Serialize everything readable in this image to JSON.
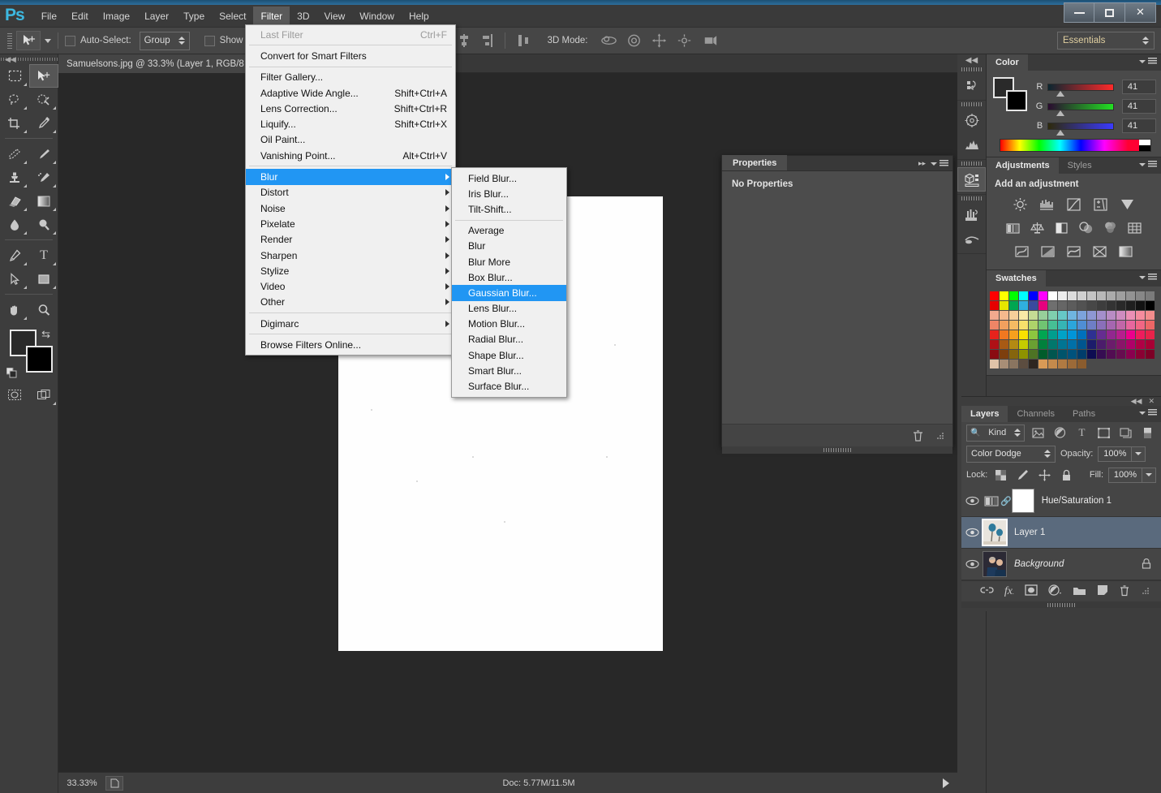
{
  "window": {
    "controls": [
      {
        "name": "minimize",
        "label": "—"
      },
      {
        "name": "maximize",
        "label": "❐"
      },
      {
        "name": "close",
        "label": "✕"
      }
    ]
  },
  "menubar": {
    "logo": "Ps",
    "items": [
      {
        "label": "File",
        "active": false
      },
      {
        "label": "Edit",
        "active": false
      },
      {
        "label": "Image",
        "active": false
      },
      {
        "label": "Layer",
        "active": false
      },
      {
        "label": "Type",
        "active": false
      },
      {
        "label": "Select",
        "active": false
      },
      {
        "label": "Filter",
        "active": true
      },
      {
        "label": "3D",
        "active": false
      },
      {
        "label": "View",
        "active": false
      },
      {
        "label": "Window",
        "active": false
      },
      {
        "label": "Help",
        "active": false
      }
    ]
  },
  "options_bar": {
    "auto_select_label": "Auto-Select:",
    "auto_select_checked": false,
    "group_value": "Group",
    "show_transform_label": "Show Tran",
    "show_transform_checked": false,
    "mode3d_label": "3D Mode:",
    "workspace": "Essentials"
  },
  "document": {
    "tab_title": "Samuelsons.jpg @ 33.3% (Layer 1, RGB/8"
  },
  "status_bar": {
    "zoom": "33.33%",
    "doc_info": "Doc: 5.77M/11.5M"
  },
  "filter_menu": {
    "items": [
      {
        "label": "Last Filter",
        "shortcut": "Ctrl+F",
        "disabled": true,
        "submenu": false,
        "highlight": false
      },
      {
        "separator": true
      },
      {
        "label": "Convert for Smart Filters",
        "shortcut": "",
        "disabled": false,
        "submenu": false,
        "highlight": false
      },
      {
        "separator": true
      },
      {
        "label": "Filter Gallery...",
        "shortcut": "",
        "disabled": false,
        "submenu": false,
        "highlight": false
      },
      {
        "label": "Adaptive Wide Angle...",
        "shortcut": "Shift+Ctrl+A",
        "disabled": false,
        "submenu": false,
        "highlight": false
      },
      {
        "label": "Lens Correction...",
        "shortcut": "Shift+Ctrl+R",
        "disabled": false,
        "submenu": false,
        "highlight": false
      },
      {
        "label": "Liquify...",
        "shortcut": "Shift+Ctrl+X",
        "disabled": false,
        "submenu": false,
        "highlight": false
      },
      {
        "label": "Oil Paint...",
        "shortcut": "",
        "disabled": false,
        "submenu": false,
        "highlight": false
      },
      {
        "label": "Vanishing Point...",
        "shortcut": "Alt+Ctrl+V",
        "disabled": false,
        "submenu": false,
        "highlight": false
      },
      {
        "separator": true
      },
      {
        "label": "Blur",
        "shortcut": "",
        "disabled": false,
        "submenu": true,
        "highlight": true
      },
      {
        "label": "Distort",
        "shortcut": "",
        "disabled": false,
        "submenu": true,
        "highlight": false
      },
      {
        "label": "Noise",
        "shortcut": "",
        "disabled": false,
        "submenu": true,
        "highlight": false
      },
      {
        "label": "Pixelate",
        "shortcut": "",
        "disabled": false,
        "submenu": true,
        "highlight": false
      },
      {
        "label": "Render",
        "shortcut": "",
        "disabled": false,
        "submenu": true,
        "highlight": false
      },
      {
        "label": "Sharpen",
        "shortcut": "",
        "disabled": false,
        "submenu": true,
        "highlight": false
      },
      {
        "label": "Stylize",
        "shortcut": "",
        "disabled": false,
        "submenu": true,
        "highlight": false
      },
      {
        "label": "Video",
        "shortcut": "",
        "disabled": false,
        "submenu": true,
        "highlight": false
      },
      {
        "label": "Other",
        "shortcut": "",
        "disabled": false,
        "submenu": true,
        "highlight": false
      },
      {
        "separator": true
      },
      {
        "label": "Digimarc",
        "shortcut": "",
        "disabled": false,
        "submenu": true,
        "highlight": false
      },
      {
        "separator": true
      },
      {
        "label": "Browse Filters Online...",
        "shortcut": "",
        "disabled": false,
        "submenu": false,
        "highlight": false
      }
    ]
  },
  "blur_submenu": {
    "items": [
      {
        "label": "Field Blur...",
        "highlight": false
      },
      {
        "label": "Iris Blur...",
        "highlight": false
      },
      {
        "label": "Tilt-Shift...",
        "highlight": false
      },
      {
        "separator": true
      },
      {
        "label": "Average",
        "highlight": false
      },
      {
        "label": "Blur",
        "highlight": false
      },
      {
        "label": "Blur More",
        "highlight": false
      },
      {
        "label": "Box Blur...",
        "highlight": false
      },
      {
        "label": "Gaussian Blur...",
        "highlight": true
      },
      {
        "label": "Lens Blur...",
        "highlight": false
      },
      {
        "label": "Motion Blur...",
        "highlight": false
      },
      {
        "label": "Radial Blur...",
        "highlight": false
      },
      {
        "label": "Shape Blur...",
        "highlight": false
      },
      {
        "label": "Smart Blur...",
        "highlight": false
      },
      {
        "label": "Surface Blur...",
        "highlight": false
      }
    ]
  },
  "properties_panel": {
    "tab": "Properties",
    "empty_text": "No Properties"
  },
  "color_panel": {
    "tab": "Color",
    "channels": [
      {
        "label": "R",
        "value": "41"
      },
      {
        "label": "G",
        "value": "41"
      },
      {
        "label": "B",
        "value": "41"
      }
    ],
    "foreground": "#2a2a2a",
    "background": "#000000"
  },
  "adjustments_panel": {
    "tabs": [
      {
        "label": "Adjustments",
        "selected": true
      },
      {
        "label": "Styles",
        "selected": false
      }
    ],
    "title": "Add an adjustment",
    "icons": [
      [
        "brightness-contrast-icon",
        "levels-icon",
        "curves-icon",
        "exposure-icon",
        "vibrance-icon"
      ],
      [
        "hue-saturation-icon",
        "color-balance-icon",
        "black-white-icon",
        "photo-filter-icon",
        "channel-mixer-icon",
        "color-lookup-icon"
      ],
      [
        "invert-icon",
        "posterize-icon",
        "threshold-icon",
        "selective-color-icon",
        "gradient-map-icon"
      ]
    ]
  },
  "swatches_panel": {
    "tab": "Swatches",
    "colors": [
      [
        "#ff0000",
        "#ffff00",
        "#00ff00",
        "#00ffff",
        "#0000ff",
        "#ff00ff",
        "#ffffff",
        "#ededed",
        "#dcdcdc",
        "#d0d0d0",
        "#c4c4c4",
        "#b8b8b8",
        "#ababab",
        "#9f9f9f",
        "#939393",
        "#878787",
        "#7b7b7b"
      ],
      [
        "#e60000",
        "#e6e600",
        "#00a651",
        "#2fb0e0",
        "#3a4a9e",
        "#e6007e",
        "#6f6f6f",
        "#666666",
        "#5c5c5c",
        "#525252",
        "#474747",
        "#3d3d3d",
        "#333333",
        "#292929",
        "#1f1f1f",
        "#121212",
        "#000000"
      ],
      [
        "#f2a98e",
        "#f5b98d",
        "#f7cf9a",
        "#faeaa6",
        "#c5dc94",
        "#97cf9a",
        "#7fcfae",
        "#66c7c7",
        "#6fb5e0",
        "#7ca3dc",
        "#8e97d4",
        "#a48fcb",
        "#b98cc4",
        "#cf8cc0",
        "#ec8fb5",
        "#f58c9e",
        "#f28c8c"
      ],
      [
        "#ef8566",
        "#f2a05e",
        "#f5bb63",
        "#f7e06b",
        "#aed36a",
        "#70c472",
        "#46bf95",
        "#35b5b5",
        "#2ba6dc",
        "#4f8ed4",
        "#6e7ec6",
        "#8a6fba",
        "#a666b0",
        "#c266a8",
        "#e8669e",
        "#f26684",
        "#ee6666"
      ],
      [
        "#e8231c",
        "#f07820",
        "#f6a01e",
        "#fae100",
        "#8cc63f",
        "#00a651",
        "#009e8e",
        "#00a3c7",
        "#0095d9",
        "#0071bc",
        "#2e3192",
        "#662d91",
        "#92278f",
        "#b61e8e",
        "#ec008c",
        "#ee1c5d",
        "#e8234a"
      ],
      [
        "#b01116",
        "#a85a14",
        "#b38a13",
        "#c6cc00",
        "#6aa032",
        "#00803c",
        "#00776c",
        "#007593",
        "#0070a8",
        "#00558f",
        "#1c1c6b",
        "#4b1c6b",
        "#6b1c6b",
        "#8a1469",
        "#b00069",
        "#b00045",
        "#a80034"
      ],
      [
        "#8a0b12",
        "#7d3f0e",
        "#85650e",
        "#8e9300",
        "#4d7324",
        "#005c2b",
        "#00564f",
        "#00546b",
        "#00527c",
        "#003d6b",
        "#0d0d52",
        "#360d52",
        "#520d52",
        "#660d4f",
        "#8a004f",
        "#8a0033",
        "#7d0026"
      ],
      [
        "#e0c3a8",
        "#a88e76",
        "#8a7560",
        "#5c4d40",
        "#2e2620",
        "#d99a56",
        "#c48a4c",
        "#b07a42",
        "#9c6a38",
        "#8a5c2e",
        "",
        "",
        "",
        "",
        "",
        "",
        ""
      ]
    ]
  },
  "layers_panel": {
    "tabs": [
      {
        "label": "Layers",
        "selected": true
      },
      {
        "label": "Channels",
        "selected": false
      },
      {
        "label": "Paths",
        "selected": false
      }
    ],
    "filter_label": "Kind",
    "blend_mode": "Color Dodge",
    "opacity_label": "Opacity:",
    "opacity_value": "100%",
    "lock_label": "Lock:",
    "fill_label": "Fill:",
    "fill_value": "100%",
    "layers": [
      {
        "name": "Hue/Saturation 1",
        "selected": false,
        "italic": false,
        "type": "adjustment",
        "locked": false,
        "visible": true
      },
      {
        "name": "Layer 1",
        "selected": true,
        "italic": false,
        "type": "pixel",
        "locked": false,
        "visible": true
      },
      {
        "name": "Background",
        "selected": false,
        "italic": true,
        "type": "pixel",
        "locked": true,
        "visible": true
      }
    ],
    "footer_icons": [
      "link-icon",
      "fx-icon",
      "add-mask-icon",
      "new-adjustment-icon",
      "new-group-icon",
      "new-layer-icon",
      "delete-layer-icon"
    ]
  },
  "tools": [
    {
      "name": "marquee-tool",
      "glyph": "▭",
      "selected": false
    },
    {
      "name": "move-tool",
      "glyph": "➤",
      "selected": true
    },
    {
      "name": "lasso-tool",
      "glyph": "◌",
      "selected": false
    },
    {
      "name": "quick-selection-tool",
      "glyph": "✣",
      "selected": false
    },
    {
      "name": "crop-tool",
      "glyph": "⌗",
      "selected": false
    },
    {
      "name": "eyedropper-tool",
      "glyph": "⚲",
      "selected": false
    },
    {
      "name": "healing-brush-tool",
      "glyph": "✎",
      "selected": false
    },
    {
      "name": "brush-tool",
      "glyph": "✒",
      "selected": false
    },
    {
      "name": "clone-stamp-tool",
      "glyph": "⎙",
      "selected": false
    },
    {
      "name": "history-brush-tool",
      "glyph": "❧",
      "selected": false
    },
    {
      "name": "eraser-tool",
      "glyph": "▰",
      "selected": false
    },
    {
      "name": "gradient-tool",
      "glyph": "▤",
      "selected": false
    },
    {
      "name": "blur-tool",
      "glyph": "💧",
      "selected": false
    },
    {
      "name": "dodge-tool",
      "glyph": "🔍",
      "selected": false
    },
    {
      "name": "pen-tool",
      "glyph": "✑",
      "selected": false
    },
    {
      "name": "type-tool",
      "glyph": "T",
      "selected": false
    },
    {
      "name": "path-selection-tool",
      "glyph": "➚",
      "selected": false
    },
    {
      "name": "rectangle-tool",
      "glyph": "▢",
      "selected": false
    },
    {
      "name": "hand-tool",
      "glyph": "✋",
      "selected": false
    },
    {
      "name": "zoom-tool",
      "glyph": "🔎",
      "selected": false
    }
  ],
  "rail_icons": [
    {
      "name": "history-icon",
      "group": 0
    },
    {
      "name": "navigator-icon",
      "group": 1
    },
    {
      "name": "histogram-icon",
      "group": 1
    },
    {
      "name": "3d-icon",
      "group": 2,
      "selected": true
    },
    {
      "name": "brush-presets-icon",
      "group": 3
    },
    {
      "name": "clone-source-icon",
      "group": 3
    }
  ]
}
